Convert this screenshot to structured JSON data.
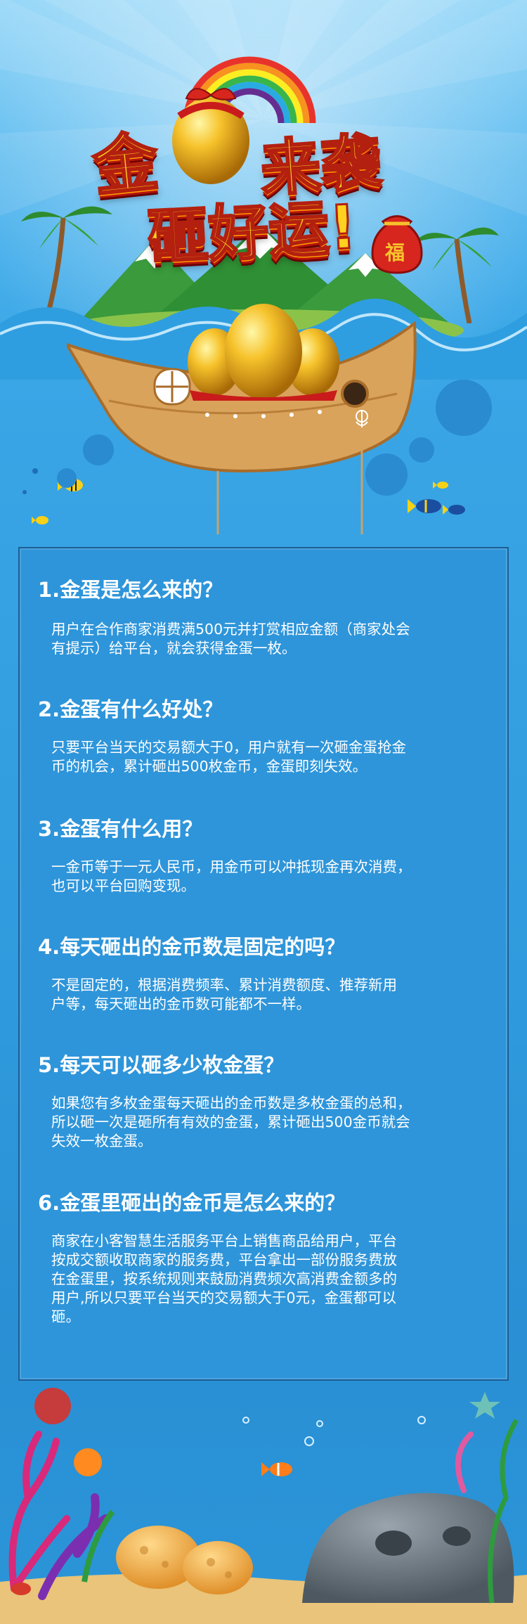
{
  "title": {
    "line1_left": "金",
    "line1_right": "来袭",
    "line2": "砸好运!",
    "bag_char": "福"
  },
  "colors": {
    "title_fill": "#ffd21f",
    "title_stroke": "#b3200f",
    "panel_bg": "#2e95da",
    "panel_border": "#1c5e94",
    "text": "#ffffff"
  },
  "icons": {
    "rainbow": "rainbow-icon",
    "golden_egg": "golden-egg-icon",
    "lucky_bag": "lucky-bag-icon",
    "boat": "boat-icon",
    "palm_tree": "palm-tree-icon",
    "fish": "fish-icon",
    "coral": "coral-icon"
  },
  "faq": [
    {
      "q": "1.金蛋是怎么来的？",
      "a": [
        "用户在合作商家消费满500元并打赏相应金额（商家处会",
        "有提示）给平台，就会获得金蛋一枚。"
      ]
    },
    {
      "q": "2.金蛋有什么好处？",
      "a": [
        "只要平台当天的交易额大于0，用户就有一次砸金蛋抢金",
        "币的机会，累计砸出500枚金币，金蛋即刻失效。"
      ]
    },
    {
      "q": "3.金蛋有什么用？",
      "a": [
        "一金币等于一元人民币，用金币可以冲抵现金再次消费，",
        "也可以平台回购变现。"
      ]
    },
    {
      "q": "4.每天砸出的金币数是固定的吗？",
      "a": [
        "不是固定的，根据消费频率、累计消费额度、推荐新用",
        "户等，每天砸出的金币数可能都不一样。"
      ]
    },
    {
      "q": "5.每天可以砸多少枚金蛋？",
      "a": [
        "如果您有多枚金蛋每天砸出的金币数是多枚金蛋的总和，",
        "所以砸一次是砸所有有效的金蛋，累计砸出500金币就会",
        "失效一枚金蛋。"
      ]
    },
    {
      "q": "6.金蛋里砸出的金币是怎么来的？",
      "a": [
        "商家在小客智慧生活服务平台上销售商品给用户，平台",
        "按成交额收取商家的服务费，平台拿出一部份服务费放",
        "在金蛋里，按系统规则来鼓励消费频次高消费金额多的",
        "用户,所以只要平台当天的交易额大于0元，金蛋都可以",
        "砸。"
      ]
    }
  ]
}
